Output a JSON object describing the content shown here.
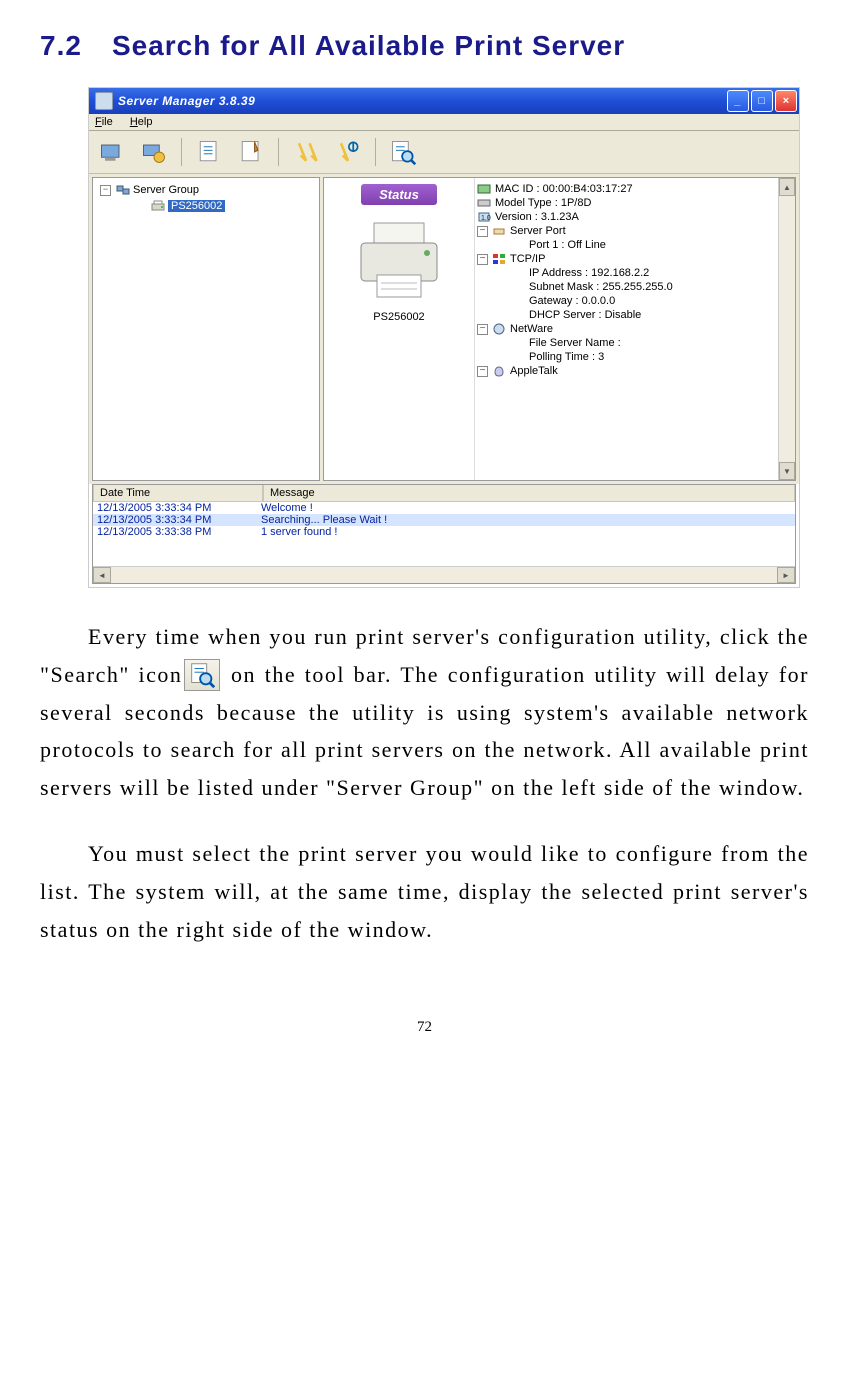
{
  "heading": {
    "number": "7.2",
    "title": "Search for All Available Print Server"
  },
  "window": {
    "title": "Server Manager 3.8.39",
    "menus": {
      "file": "File",
      "help": "Help",
      "file_key": "F",
      "help_key": "H"
    },
    "tree": {
      "group_label": "Server Group",
      "selected": "PS256002"
    },
    "status": {
      "tab": "Status",
      "device": "PS256002",
      "items": {
        "mac": "MAC ID : 00:00:B4:03:17:27",
        "model": "Model Type : 1P/8D",
        "version": "Version : 3.1.23A",
        "server_port": "Server Port",
        "port1": "Port 1 : Off Line",
        "tcpip": "TCP/IP",
        "ip": "IP Address : 192.168.2.2",
        "subnet": "Subnet Mask : 255.255.255.0",
        "gateway": "Gateway : 0.0.0.0",
        "dhcp": "DHCP Server : Disable",
        "netware": "NetWare",
        "fileserver": "File Server Name :",
        "polling": "Polling Time : 3",
        "appletalk": "AppleTalk"
      }
    },
    "log": {
      "col_datetime": "Date Time",
      "col_message": "Message",
      "rows": [
        {
          "dt": "12/13/2005 3:33:34 PM",
          "msg": "Welcome !"
        },
        {
          "dt": "12/13/2005 3:33:34 PM",
          "msg": "Searching... Please Wait !"
        },
        {
          "dt": "12/13/2005 3:33:38 PM",
          "msg": "1 server found !"
        }
      ]
    }
  },
  "body": {
    "p1a": "Every time when you run print server's configuration utility, click the \"Search\" icon",
    "p1b": " on the tool bar. The configuration utility will delay for several seconds because the utility is using system's available network protocols to search for all print servers on the network. All available print servers will be listed under \"Server Group\" on the left side of the window.",
    "p2": "You must select the print server you would like to configure from the list. The system will, at the same time, display the selected print server's status on the right side of the window."
  },
  "page_number": "72"
}
